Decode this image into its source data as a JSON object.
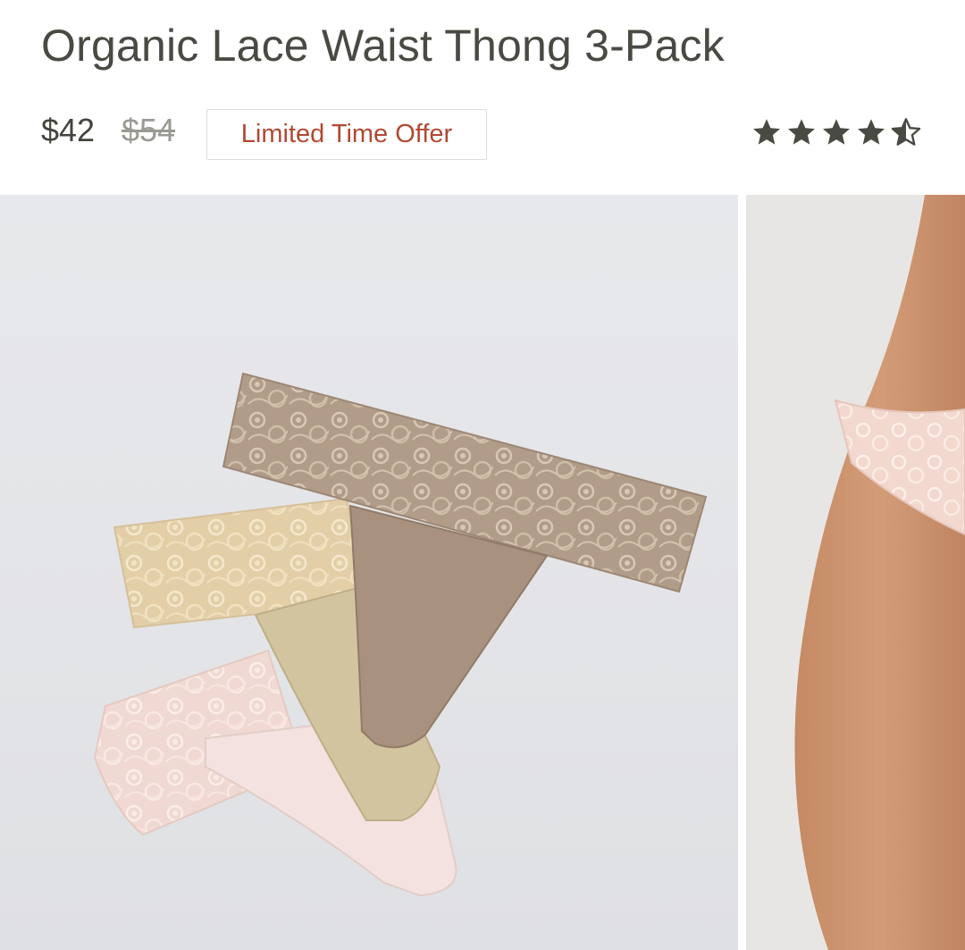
{
  "product": {
    "title": "Organic Lace Waist Thong 3-Pack",
    "price": "$42",
    "original_price": "$54",
    "badge": "Limited Time Offer",
    "rating": 4.5
  },
  "colors": {
    "text": "#4a4a44",
    "badge_text": "#b04a34",
    "star": "#4a4a44"
  },
  "icons": [
    "star-icon",
    "star-icon",
    "star-icon",
    "star-icon",
    "half-star-icon"
  ]
}
